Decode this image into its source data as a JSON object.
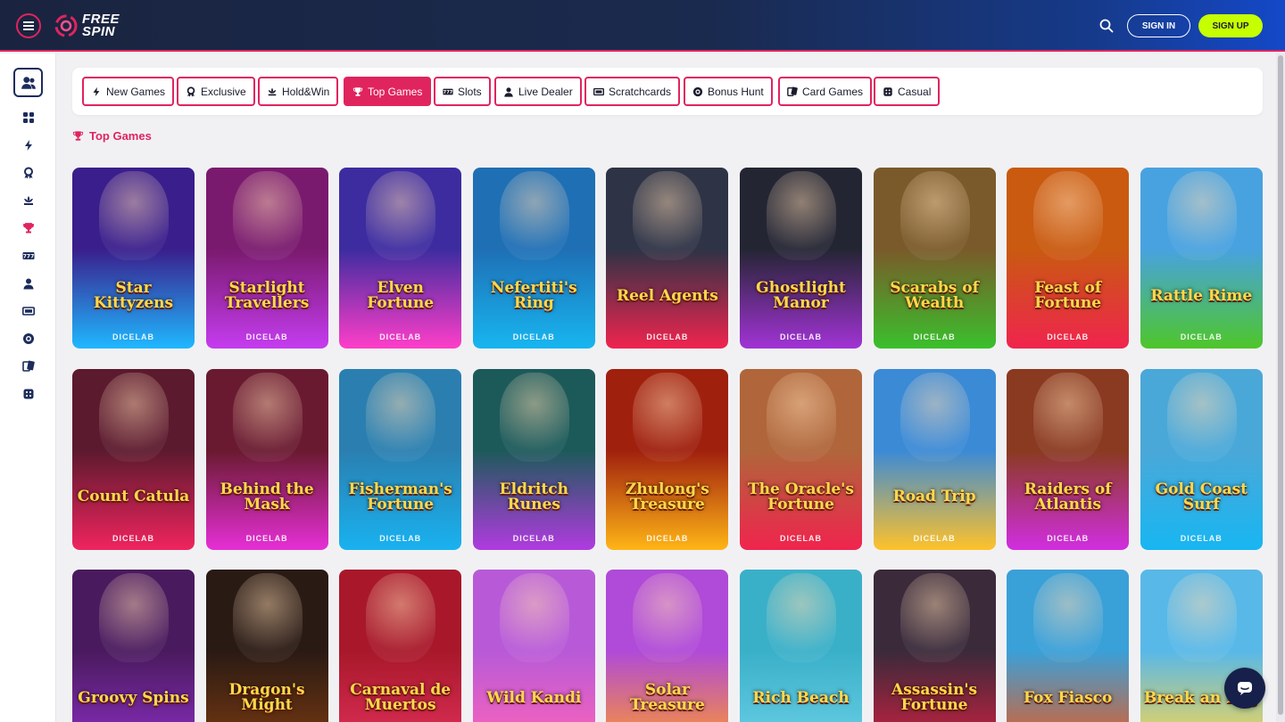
{
  "header": {
    "logo_line1": "FREE",
    "logo_line2": "SPIN",
    "signin_label": "SIGN IN",
    "signup_label": "SIGN UP"
  },
  "categories": [
    {
      "label": "New Games",
      "icon": "lightning-icon"
    },
    {
      "label": "Exclusive",
      "icon": "medal-icon"
    },
    {
      "label": "Hold&Win",
      "icon": "lotus-icon"
    },
    {
      "label": "Top Games",
      "icon": "trophy-icon",
      "active": true
    },
    {
      "label": "Slots",
      "icon": "slot-777-icon"
    },
    {
      "label": "Live Dealer",
      "icon": "person-icon"
    },
    {
      "label": "Scratchcards",
      "icon": "ticket-icon"
    },
    {
      "label": "Bonus Hunt",
      "icon": "chip-icon"
    },
    {
      "label": "Card Games",
      "icon": "cards-icon"
    },
    {
      "label": "Casual",
      "icon": "dice-icon"
    }
  ],
  "section": {
    "title": "Top Games"
  },
  "provider": "DICELAB",
  "games": [
    {
      "title": "Star Kittyzens",
      "color1": "#3a1e8c",
      "color2": "#1fb8ff"
    },
    {
      "title": "Starlight Travellers",
      "color1": "#7a1a6e",
      "color2": "#c53cf0"
    },
    {
      "title": "Elven Fortune",
      "color1": "#3d2ca0",
      "color2": "#ff3ec9"
    },
    {
      "title": "Nefertiti's Ring",
      "color1": "#1f6fb5",
      "color2": "#17b6f0"
    },
    {
      "title": "Reel Agents",
      "color1": "#2e3346",
      "color2": "#f0244e"
    },
    {
      "title": "Ghostlight Manor",
      "color1": "#242533",
      "color2": "#a233d6"
    },
    {
      "title": "Scarabs of Wealth",
      "color1": "#7a5a2a",
      "color2": "#3ac02c"
    },
    {
      "title": "Feast of Fortune",
      "color1": "#c95a10",
      "color2": "#f0244e"
    },
    {
      "title": "Rattle Rime",
      "color1": "#48a2e0",
      "color2": "#4ec62a"
    },
    {
      "title": "Count Catula",
      "color1": "#5c1a2e",
      "color2": "#f0245e"
    },
    {
      "title": "Behind the Mask",
      "color1": "#6a1a30",
      "color2": "#e62fd6"
    },
    {
      "title": "Fisherman's Fortune",
      "color1": "#2a7fb0",
      "color2": "#19b2f0"
    },
    {
      "title": "Eldritch Runes",
      "color1": "#1c5a5a",
      "color2": "#b03be0"
    },
    {
      "title": "Zhulong's Treasure",
      "color1": "#a0200e",
      "color2": "#ffb516"
    },
    {
      "title": "The Oracle's Fortune",
      "color1": "#b0663a",
      "color2": "#f0244e"
    },
    {
      "title": "Road Trip",
      "color1": "#3b8ad6",
      "color2": "#ffc22a"
    },
    {
      "title": "Raiders of Atlantis",
      "color1": "#8a3a20",
      "color2": "#d12ee0"
    },
    {
      "title": "Gold Coast Surf",
      "color1": "#4aa8d8",
      "color2": "#18b6f2"
    },
    {
      "title": "Groovy Spins",
      "color1": "#4a1a5e",
      "color2": "#8a2ec0"
    },
    {
      "title": "Dragon's Might",
      "color1": "#2a1a14",
      "color2": "#7a3a10"
    },
    {
      "title": "Carnaval de Muertos",
      "color1": "#a8182a",
      "color2": "#e0305a"
    },
    {
      "title": "Wild Kandi",
      "color1": "#b85ad8",
      "color2": "#ff64b8"
    },
    {
      "title": "Solar Treasure",
      "color1": "#b04ad8",
      "color2": "#ff9a2a"
    },
    {
      "title": "Rich Beach",
      "color1": "#3ab0c8",
      "color2": "#6ad0e8"
    },
    {
      "title": "Assassin's Fortune",
      "color1": "#3a2a3a",
      "color2": "#d02040"
    },
    {
      "title": "Fox Fiasco",
      "color1": "#3aa0d8",
      "color2": "#e85a20"
    },
    {
      "title": "Break an Egg",
      "color1": "#58b8e8",
      "color2": "#ffd84a"
    }
  ]
}
